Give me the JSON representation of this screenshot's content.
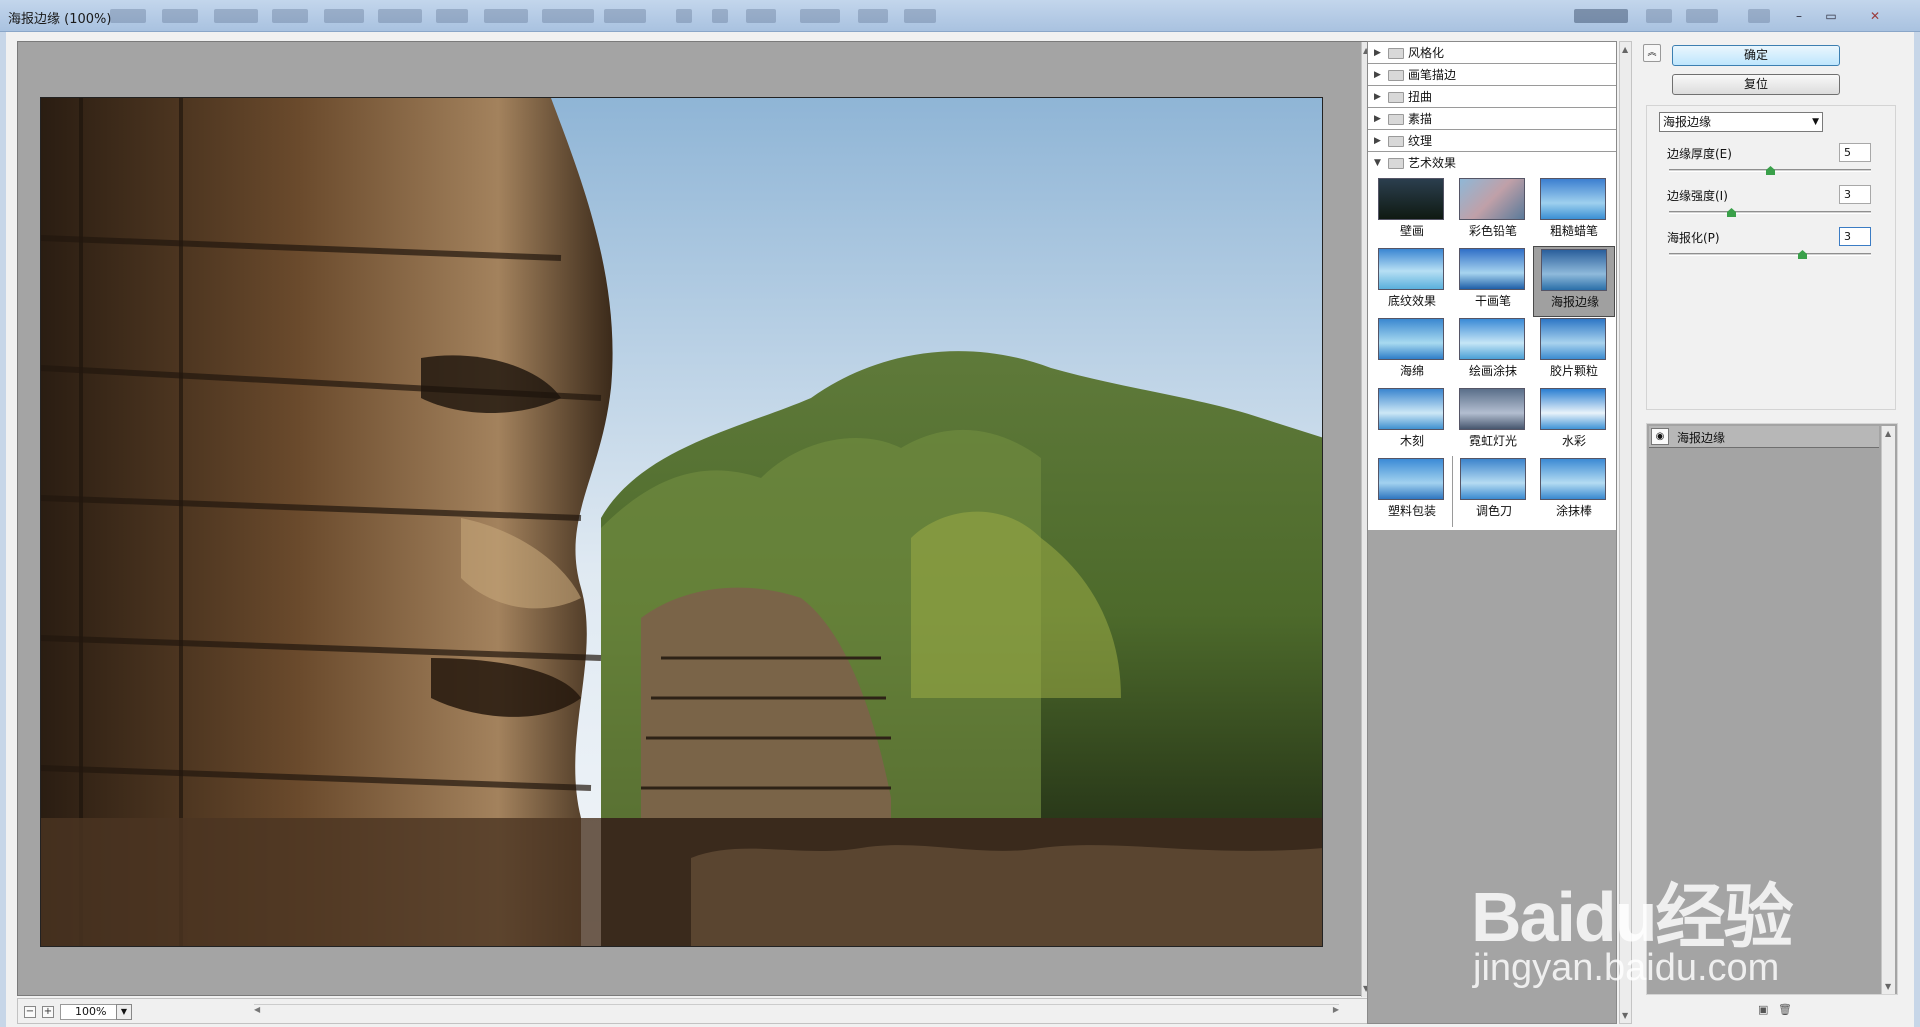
{
  "window": {
    "title": "海报边缘 (100%)"
  },
  "preview": {
    "zoom": "100%"
  },
  "filter_gallery": {
    "categories": [
      {
        "label": "风格化",
        "expanded": false
      },
      {
        "label": "画笔描边",
        "expanded": false
      },
      {
        "label": "扭曲",
        "expanded": false
      },
      {
        "label": "素描",
        "expanded": false
      },
      {
        "label": "纹理",
        "expanded": false
      },
      {
        "label": "艺术效果",
        "expanded": true
      }
    ],
    "thumbnails": [
      "壁画",
      "彩色铅笔",
      "粗糙蜡笔",
      "底纹效果",
      "干画笔",
      "海报边缘",
      "海绵",
      "绘画涂抹",
      "胶片颗粒",
      "木刻",
      "霓虹灯光",
      "水彩",
      "塑料包装",
      "调色刀",
      "涂抹棒"
    ],
    "selected": "海报边缘"
  },
  "buttons": {
    "ok": "确定",
    "reset": "复位"
  },
  "settings": {
    "filter_select": "海报边缘",
    "sliders": [
      {
        "label": "边缘厚度(E)",
        "value": "5",
        "level": 0.5
      },
      {
        "label": "边缘强度(I)",
        "value": "3",
        "level": 0.3
      },
      {
        "label": "海报化(P)",
        "value": "3",
        "level": 0.667
      }
    ]
  },
  "layers": {
    "items": [
      {
        "name": "海报边缘",
        "visible": true
      }
    ]
  },
  "watermark": {
    "logo": "Baidu经验",
    "url": "jingyan.baidu.com"
  },
  "colors": {
    "ok_border": "#3c7fb1",
    "panel_gray": "#a4a4a4",
    "knob": "#3aa04a"
  }
}
